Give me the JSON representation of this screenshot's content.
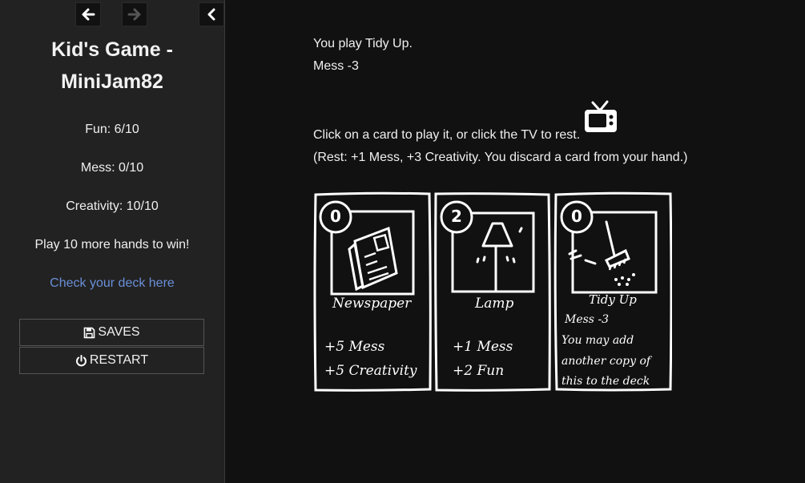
{
  "sidebar": {
    "title": "Kid's Game - MiniJam82",
    "fun": "Fun: 6/10",
    "mess": "Mess: 0/10",
    "creativity": "Creativity: 10/10",
    "hands_left": "Play 10 more hands to win!",
    "deck_link": "Check your deck here",
    "saves_label": "SAVES",
    "restart_label": "RESTART",
    "icons": [
      "back-arrow-icon",
      "forward-arrow-icon",
      "collapse-chevron-icon",
      "floppy-disk-icon",
      "power-icon"
    ]
  },
  "main": {
    "last_action": "You play Tidy Up.",
    "last_effect": "Mess -3",
    "instruction": "Click on a card to play it, or click the TV to rest.",
    "rest_info": "(Rest: +1 Mess, +3 Creativity. You discard a card from your hand.)"
  },
  "cards": [
    {
      "cost": "0",
      "name": "Newspaper",
      "effects": [
        "+5 Mess",
        "+5 Creativity"
      ],
      "icon": "newspaper-icon"
    },
    {
      "cost": "2",
      "name": "Lamp",
      "effects": [
        "+1 Mess",
        "+2 Fun"
      ],
      "icon": "lamp-icon"
    },
    {
      "cost": "0",
      "name": "Tidy Up",
      "effects": [
        "Mess -3",
        "You may add",
        "another copy of",
        "this to the deck"
      ],
      "icon": "broom-icon"
    }
  ],
  "colors": {
    "sidebar_bg": "#222222",
    "main_bg": "#111111",
    "link": "#6a8fd8",
    "text": "#f0f0f0"
  }
}
